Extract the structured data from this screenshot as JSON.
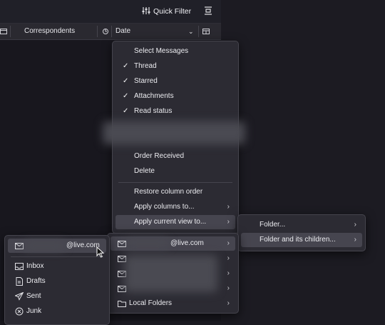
{
  "toolbar": {
    "quick_filter": "Quick Filter"
  },
  "columns": {
    "correspondents": "Correspondents",
    "date": "Date"
  },
  "context_menu": {
    "select_messages": "Select Messages",
    "thread": "Thread",
    "starred": "Starred",
    "attachments": "Attachments",
    "read_status": "Read status",
    "order_received": "Order Received",
    "delete": "Delete",
    "restore_column_order": "Restore column order",
    "apply_columns_to": "Apply columns to...",
    "apply_current_view_to": "Apply current view to..."
  },
  "submenu_folder": {
    "folder": "Folder...",
    "folder_and_children": "Folder and its children..."
  },
  "submenu_accounts": {
    "account1": "@live.com",
    "local_folders": "Local Folders"
  },
  "folder_picker": {
    "account": "@live.com",
    "inbox": "Inbox",
    "drafts": "Drafts",
    "sent": "Sent",
    "junk": "Junk"
  }
}
